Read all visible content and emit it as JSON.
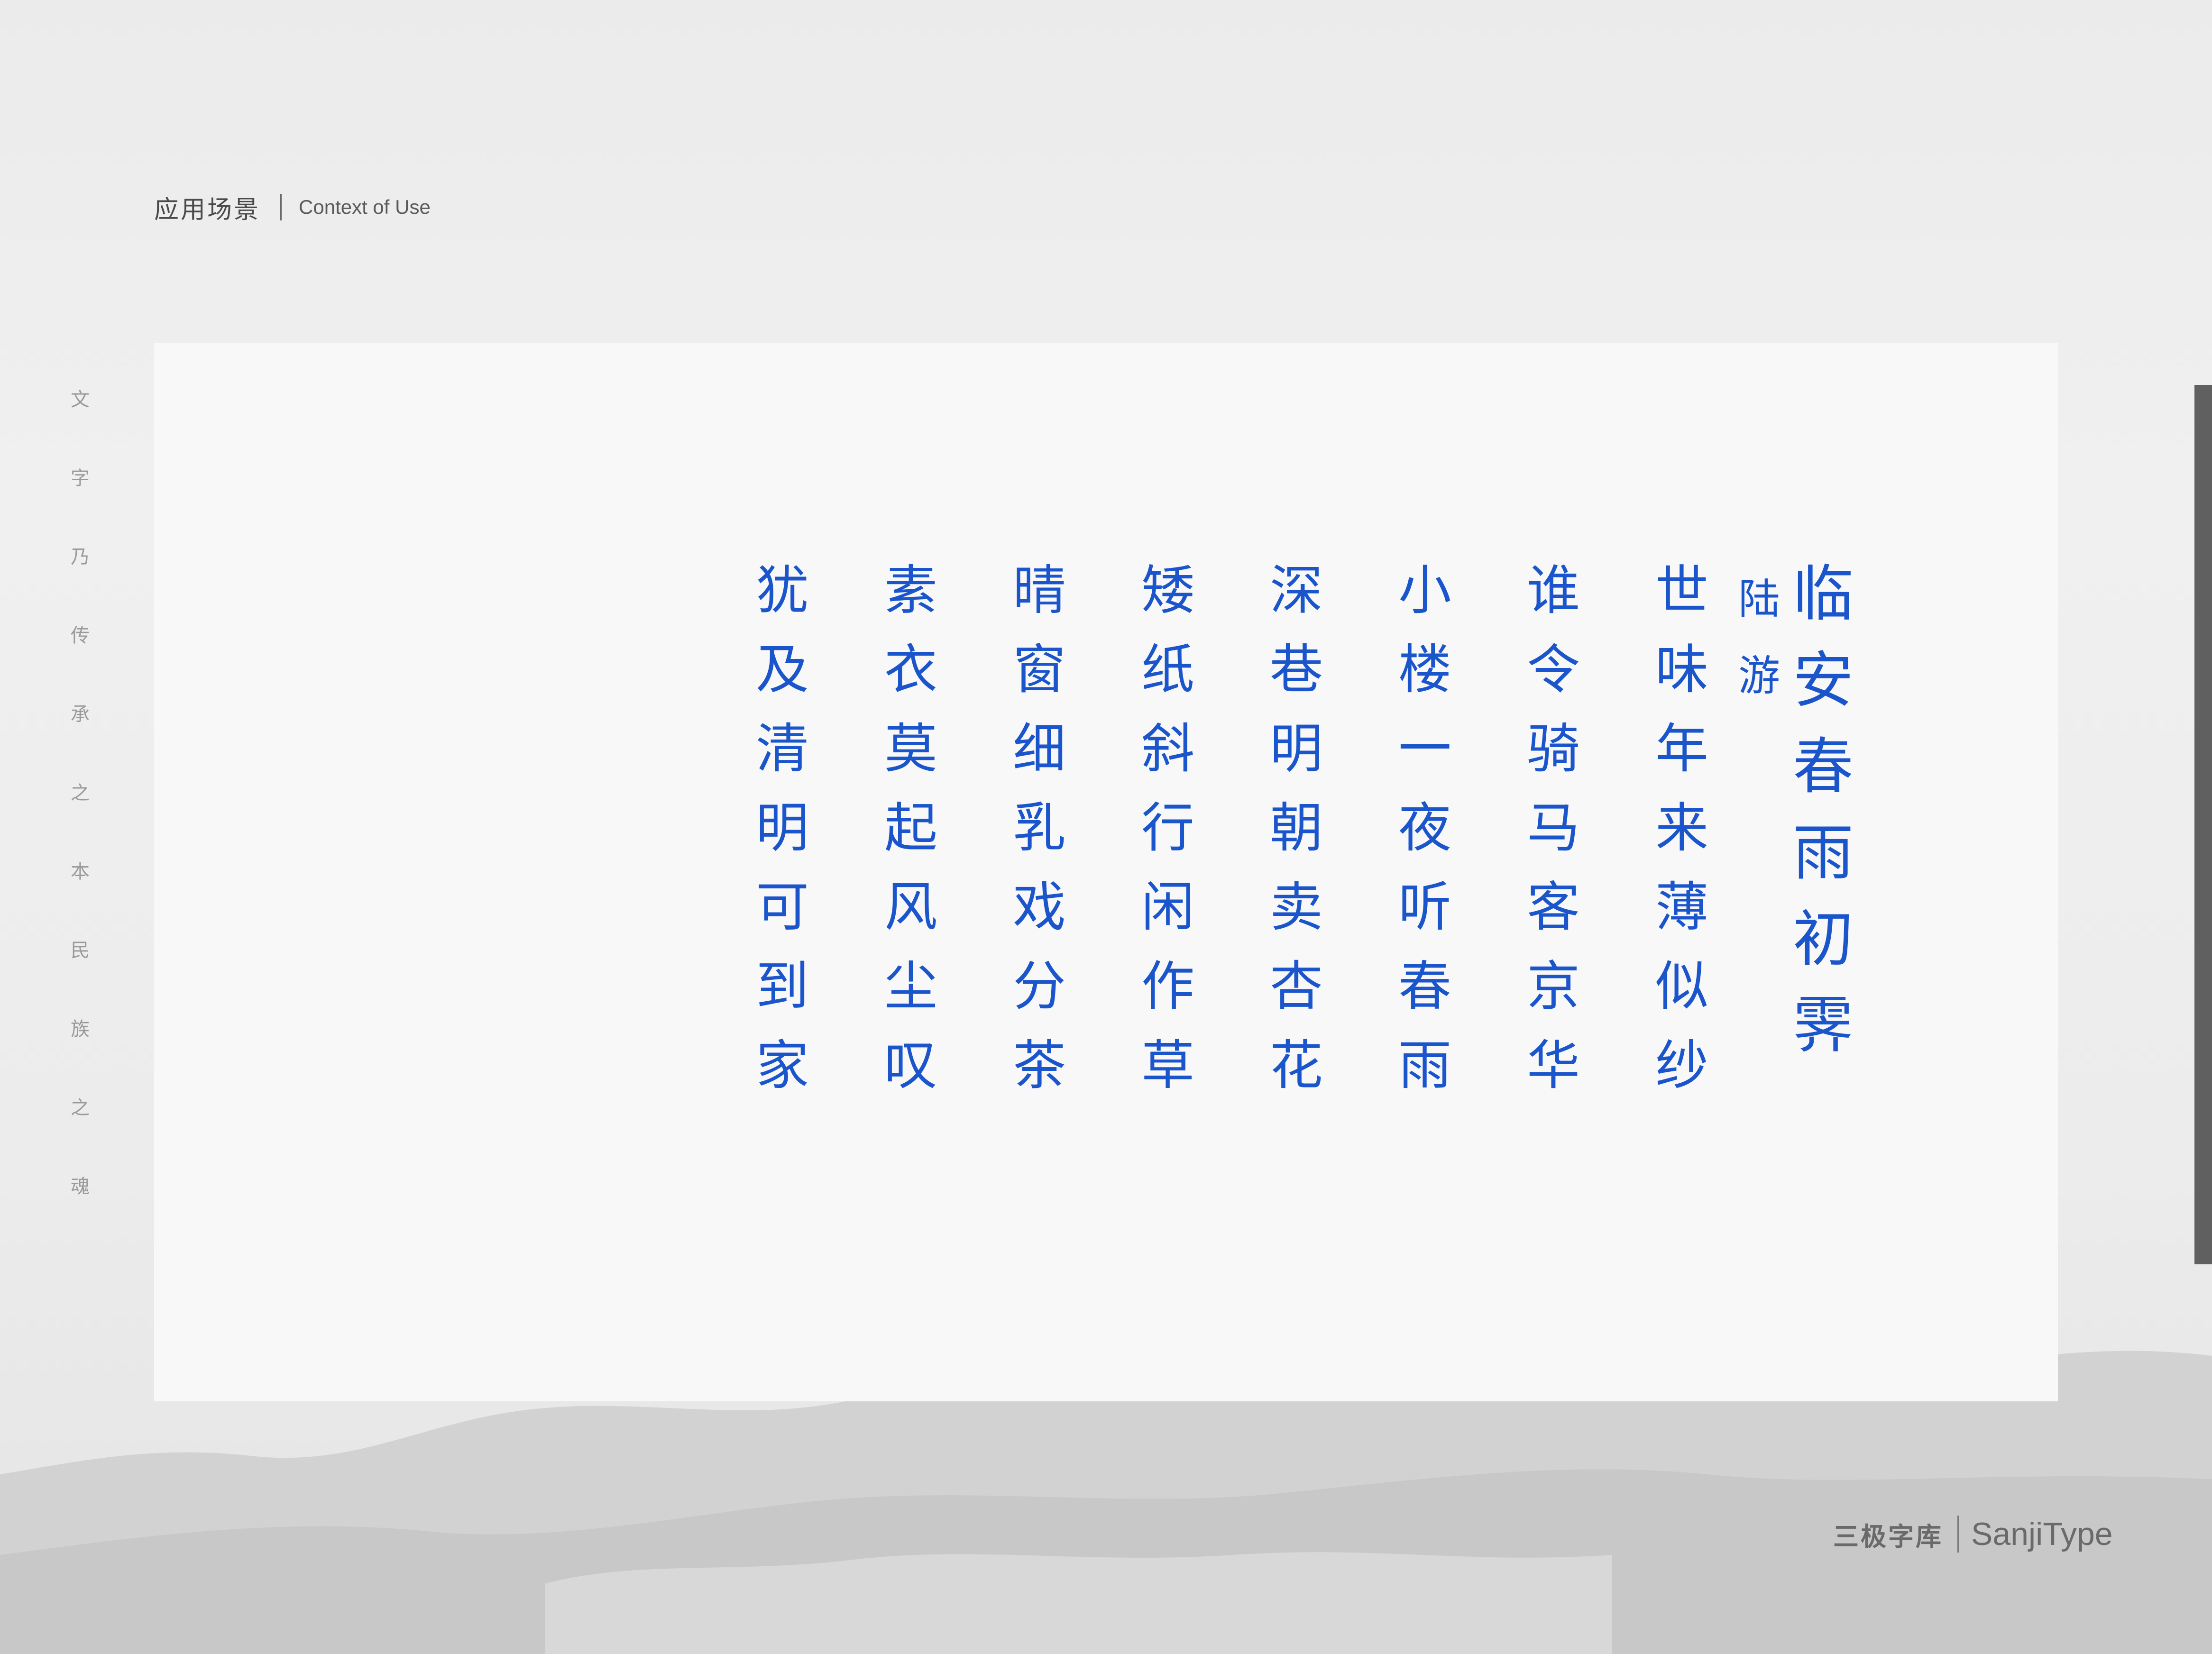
{
  "header": {
    "title_cn": "应用场景",
    "title_en": "Context of Use"
  },
  "side_text": [
    "文",
    "字",
    "乃",
    "传",
    "承",
    "之",
    "本",
    "民",
    "族",
    "之",
    "魂"
  ],
  "poem": {
    "title": [
      "临",
      "安",
      "春",
      "雨",
      "初",
      "霁"
    ],
    "author": [
      "陆",
      "游"
    ],
    "lines": [
      [
        "世",
        "味",
        "年",
        "来",
        "薄",
        "似",
        "纱"
      ],
      [
        "谁",
        "令",
        "骑",
        "马",
        "客",
        "京",
        "华"
      ],
      [
        "小",
        "楼",
        "一",
        "夜",
        "听",
        "春",
        "雨"
      ],
      [
        "深",
        "巷",
        "明",
        "朝",
        "卖",
        "杏",
        "花"
      ],
      [
        "矮",
        "纸",
        "斜",
        "行",
        "闲",
        "作",
        "草"
      ],
      [
        "晴",
        "窗",
        "细",
        "乳",
        "戏",
        "分",
        "茶"
      ],
      [
        "素",
        "衣",
        "莫",
        "起",
        "风",
        "尘",
        "叹"
      ],
      [
        "犹",
        "及",
        "清",
        "明",
        "可",
        "到",
        "家"
      ]
    ],
    "ink_color": "#1b55cc"
  },
  "footer": {
    "brand_cn": "三极字库",
    "brand_en": "SanjiType"
  }
}
